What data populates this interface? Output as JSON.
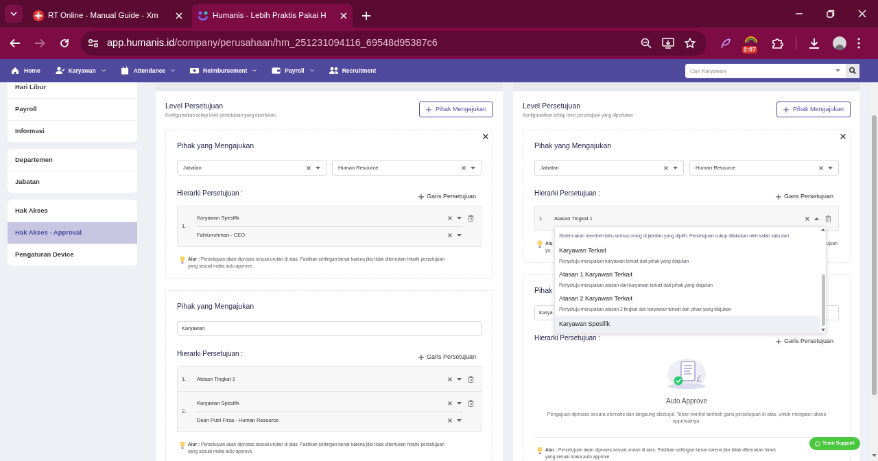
{
  "browser": {
    "tabs": [
      {
        "title": "RT Online - Manual Guide - Xm",
        "selected": false
      },
      {
        "title": "Humanis - Lebih Praktis Pakai H",
        "selected": true
      }
    ],
    "url_host": "app.humanis.id",
    "url_path": "/company/perusahaan/hm_251231094116_69548d95387c6",
    "extension_badge": "2:07"
  },
  "nav": {
    "items": [
      {
        "label": "Home",
        "dropdown": false
      },
      {
        "label": "Karyawan",
        "dropdown": true
      },
      {
        "label": "Attendance",
        "dropdown": true
      },
      {
        "label": "Reimbursement",
        "dropdown": true
      },
      {
        "label": "Payroll",
        "dropdown": true
      },
      {
        "label": "Recruitment",
        "dropdown": false
      }
    ],
    "search": {
      "placeholder": "Cari Karyawan"
    }
  },
  "sidebar": {
    "groups": [
      {
        "items": [
          {
            "label": "Hari Libur",
            "selected": false
          },
          {
            "label": "Payroll",
            "selected": false
          },
          {
            "label": "Informasi",
            "selected": false
          }
        ]
      },
      {
        "items": [
          {
            "label": "Departemen",
            "selected": false
          },
          {
            "label": "Jabatan",
            "selected": false
          }
        ]
      },
      {
        "items": [
          {
            "label": "Hak Akses",
            "selected": false
          },
          {
            "label": "Hak Akses - Approval",
            "selected": true
          },
          {
            "label": "Pengaturan Device",
            "selected": false
          }
        ]
      }
    ]
  },
  "panels": [
    {
      "title": "Level Persetujuan",
      "subtitle": "Konfigurasikan setiap level persetujuan yang diperlukan",
      "add_button": "Pihak Mengajukan",
      "cards": [
        {
          "closable": true,
          "heading": "Pihak yang Mengajukan",
          "source": {
            "kind": "selects",
            "values": [
              "Jabatan",
              "Human Resource"
            ]
          },
          "hierarchy_heading": "Hierarki Persetujuan :",
          "add_line": "Garis Persetujuan",
          "levels": [
            {
              "number": "1.",
              "expanded": false,
              "fields": [
                "Karyawan Spesifik",
                "Fahturrohman - CEO"
              ]
            }
          ],
          "note": {
            "kind": "full",
            "lines": [
              "**Alur :** Persetujuan akan diproses sesuai urutan di atas. Pastikan settingan benar karena jika tidak ditemukan hirarki persetujuan",
              "yang sesuai maka auto approve."
            ]
          }
        },
        {
          "closable": false,
          "heading": "Pihak yang Mengajukan",
          "source": {
            "kind": "input",
            "value": "Karyawan"
          },
          "hierarchy_heading": "Hierarki Persetujuan :",
          "add_line": "Garis Persetujuan",
          "levels": [
            {
              "number": "1.",
              "expanded": false,
              "fields": [
                "Atasan Tingkat 1"
              ]
            },
            {
              "number": "2.",
              "expanded": false,
              "fields": [
                "Karyawan Spesifik",
                "Dean Putri Firza - Human Resource"
              ]
            }
          ],
          "note": {
            "kind": "full",
            "lines": [
              "**Alur :** Persetujuan akan diproses sesuai urutan di atas. Pastikan settingan benar karena jika tidak ditemukan hirarki persetujuan",
              "yang sesuai maka auto approve."
            ]
          }
        }
      ]
    },
    {
      "title": "Level Persetujuan",
      "subtitle": "Konfigurasikan setiap level persetujuan yang diperlukan",
      "add_button": "Pihak Mengajukan",
      "cards": [
        {
          "closable": true,
          "heading": "Pihak yang Mengajukan",
          "source": {
            "kind": "selects",
            "values": [
              "Jabatan",
              "Human Resource"
            ]
          },
          "hierarchy_heading": "Hierarki Persetujuan :",
          "add_line": "Garis Persetujuan",
          "levels": [
            {
              "number": "1.",
              "expanded": true,
              "fields": [
                "Atasan Tingkat 1"
              ],
              "options": [
                {
                  "description": "Sistem akan memberi tahu semua orang di jabatan yang dipilih. Persetujuan cukup dilakukan oleh salah satu dari",
                  "hovered": false
                },
                {
                  "title": "Karyawan Terkait",
                  "description": "Penyetuju merupakan karyawan terkait dari pihak yang diajukan",
                  "hovered": false
                },
                {
                  "title": "Atasan 1 Karyawan Terkait",
                  "description": "Penyetuju merupakan atasan dari karyawan terkait dari pihak yang diajukan",
                  "hovered": false
                },
                {
                  "title": "Atasan 2 Karyawan Terkait",
                  "description": "Penyetuju merupakan atasan 2 tingkat dari karyawan terkait dari pihak yang diajukan",
                  "hovered": false
                },
                {
                  "title": "Karyawan Spesifik",
                  "hovered": true
                }
              ]
            }
          ],
          "note": {
            "kind": "partial",
            "label": "Alu",
            "line2": "ya",
            "tail": "ujuan"
          }
        },
        {
          "closable": false,
          "heading": "Pihak",
          "source": {
            "kind": "input",
            "value": "Karya"
          },
          "hierarchy_heading": "Hierarki Persetujuan :",
          "add_line": "Garis Persetujuan",
          "empty": {
            "title": "Auto Approve",
            "text": "Pengajuan diproses secara otomatis dan langsung disetujui. Tekan tombol tambah garis persetujuan di atas, untuk mengatur akses approvalnya."
          },
          "note": {
            "kind": "full",
            "lines": [
              "**Alur :** Persetujuan akan diproses sesuai urutan di atas. Pastikan settingan benar karena jika tidak ditemukan hirark",
              "yang sesuai maka auto approve."
            ]
          }
        }
      ]
    }
  ],
  "support_button": "Team Support"
}
